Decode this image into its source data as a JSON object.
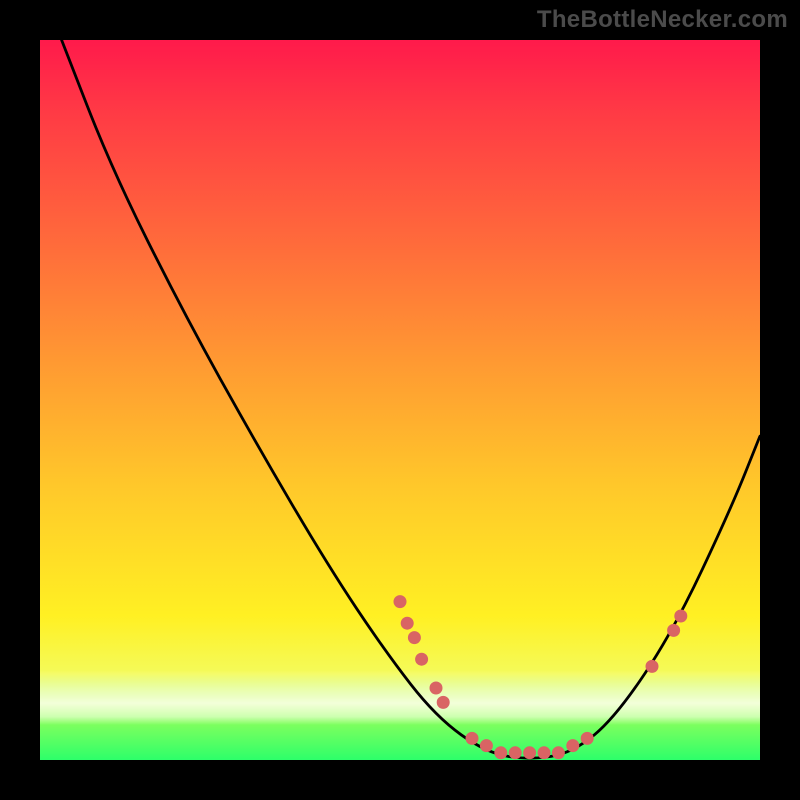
{
  "watermark": "TheBottleNecker.com",
  "chart_data": {
    "type": "line",
    "title": "",
    "xlabel": "",
    "ylabel": "",
    "xlim": [
      0,
      100
    ],
    "ylim": [
      0,
      100
    ],
    "grid": false,
    "legend": false,
    "background_gradient": {
      "direction": "vertical",
      "stops": [
        {
          "offset": 0.0,
          "color": "#ff1a4b"
        },
        {
          "offset": 0.1,
          "color": "#ff3a45"
        },
        {
          "offset": 0.28,
          "color": "#ff6a3b"
        },
        {
          "offset": 0.45,
          "color": "#ff9a32"
        },
        {
          "offset": 0.62,
          "color": "#ffc82a"
        },
        {
          "offset": 0.8,
          "color": "#fff023"
        },
        {
          "offset": 0.88,
          "color": "#f4fb5a"
        },
        {
          "offset": 0.95,
          "color": "#7dff5e"
        },
        {
          "offset": 1.0,
          "color": "#2dff6a"
        }
      ],
      "pale_haze_band": {
        "bottom_from": 0.9,
        "height_frac": 0.08
      }
    },
    "series": [
      {
        "name": "bottleneck-curve",
        "stroke": "#000000",
        "points": [
          {
            "x": 3,
            "y": 100
          },
          {
            "x": 10,
            "y": 82
          },
          {
            "x": 20,
            "y": 62
          },
          {
            "x": 30,
            "y": 44
          },
          {
            "x": 40,
            "y": 27
          },
          {
            "x": 48,
            "y": 15
          },
          {
            "x": 55,
            "y": 6
          },
          {
            "x": 62,
            "y": 1
          },
          {
            "x": 68,
            "y": 0
          },
          {
            "x": 74,
            "y": 1
          },
          {
            "x": 80,
            "y": 6
          },
          {
            "x": 88,
            "y": 18
          },
          {
            "x": 96,
            "y": 35
          },
          {
            "x": 100,
            "y": 45
          }
        ]
      }
    ],
    "highlight_points": {
      "name": "salmon-dots",
      "color": "#d96464",
      "radius": 6,
      "points": [
        {
          "x": 50,
          "y": 22
        },
        {
          "x": 51,
          "y": 19
        },
        {
          "x": 52,
          "y": 17
        },
        {
          "x": 53,
          "y": 14
        },
        {
          "x": 55,
          "y": 10
        },
        {
          "x": 56,
          "y": 8
        },
        {
          "x": 60,
          "y": 3
        },
        {
          "x": 62,
          "y": 2
        },
        {
          "x": 64,
          "y": 1
        },
        {
          "x": 66,
          "y": 1
        },
        {
          "x": 68,
          "y": 1
        },
        {
          "x": 70,
          "y": 1
        },
        {
          "x": 72,
          "y": 1
        },
        {
          "x": 74,
          "y": 2
        },
        {
          "x": 76,
          "y": 3
        },
        {
          "x": 85,
          "y": 13
        },
        {
          "x": 88,
          "y": 18
        },
        {
          "x": 89,
          "y": 20
        }
      ]
    }
  }
}
